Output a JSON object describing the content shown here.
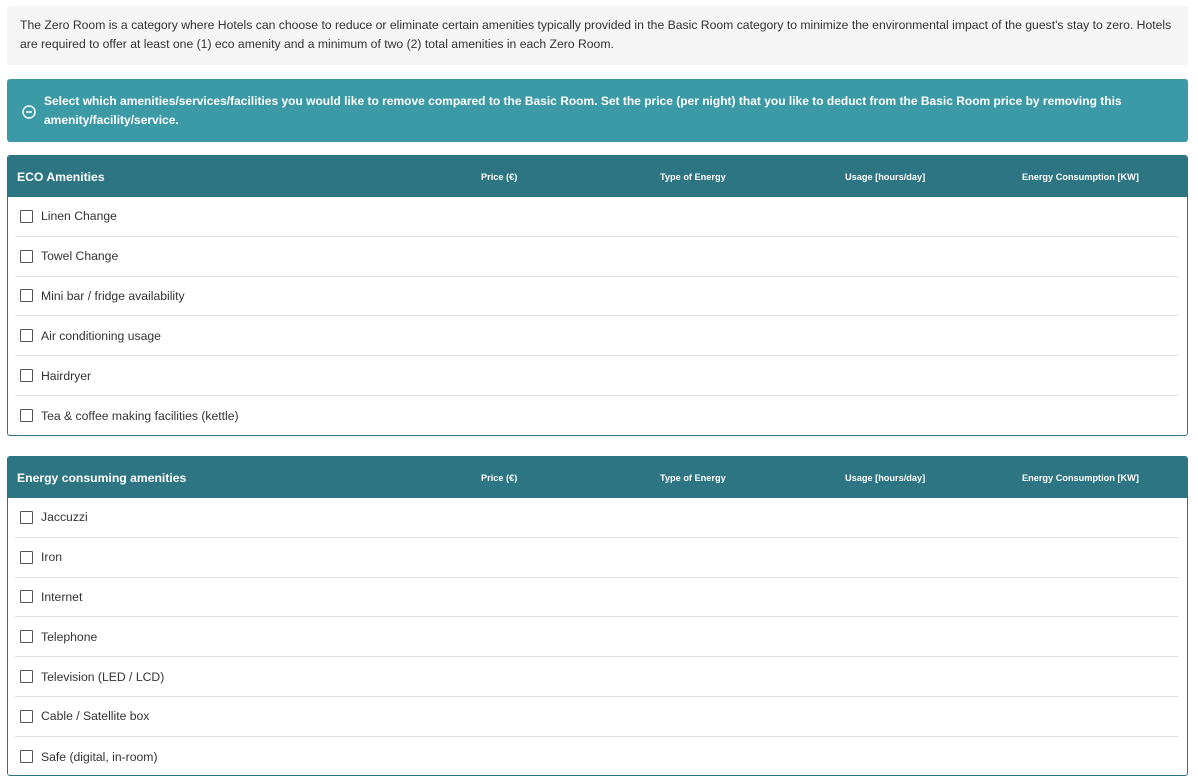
{
  "intro": {
    "text": "The Zero Room is a category where Hotels can choose to reduce or eliminate certain amenities typically provided in the Basic Room category to minimize the environmental impact of the guest's stay to zero. Hotels are required to offer at least one (1) eco amenity and a minimum of two (2) total amenities in each Zero Room."
  },
  "info": {
    "icon": "minus-circle-icon",
    "text": "Select which amenities/services/facilities you would like to remove compared to the Basic Room. Set the price (per night) that you like to deduct from the Basic Room price by removing this amenity/facility/service."
  },
  "columns": {
    "price": "Price (€)",
    "type": "Type of Energy",
    "usage": "Usage [hours/day]",
    "energy": "Energy Consumption [KW]"
  },
  "eco": {
    "title": "ECO Amenities",
    "items": [
      "Linen Change",
      "Towel Change",
      "Mini bar / fridge availability",
      "Air conditioning usage",
      "Hairdryer",
      "Tea & coffee making facilities (kettle)"
    ]
  },
  "energy": {
    "title": "Energy consuming amenities",
    "items": [
      "Jaccuzzi",
      "Iron",
      "Internet",
      "Telephone",
      "Television (LED / LCD)",
      "Cable / Satellite box",
      "Safe (digital, in-room)"
    ]
  },
  "colors": {
    "info_bg": "#3b9aa6",
    "header_bg": "#2d7582",
    "intro_bg": "#f5f5f5"
  }
}
